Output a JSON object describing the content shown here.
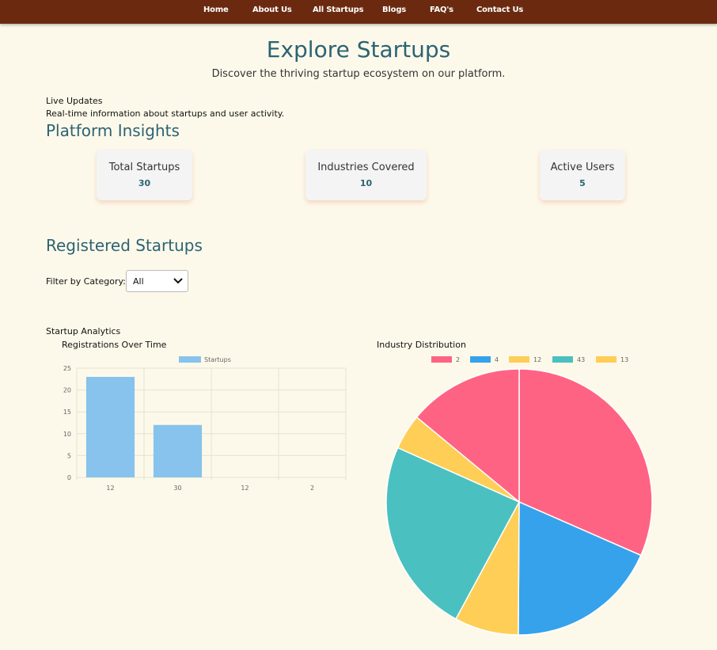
{
  "nav": {
    "items": [
      "Home",
      "About Us",
      "All Startups",
      "Blogs",
      "FAQ's",
      "Contact Us"
    ]
  },
  "hero": {
    "title": "Explore Startups",
    "subtitle": "Discover the thriving startup ecosystem on our platform."
  },
  "live": {
    "heading": "Live Updates",
    "description": "Real-time information about startups and user activity."
  },
  "insights": {
    "heading": "Platform Insights",
    "cards": [
      {
        "label": "Total Startups",
        "value": "30"
      },
      {
        "label": "Industries Covered",
        "value": "10"
      },
      {
        "label": "Active Users",
        "value": "5"
      }
    ]
  },
  "registered": {
    "heading": "Registered Startups",
    "filter_label": "Filter by Category:",
    "filter_value": "All"
  },
  "analytics": {
    "heading": "Startup Analytics"
  },
  "colors": {
    "accent": "#2c6373",
    "nav_bg": "#6b2a10",
    "page_bg": "#fdf9ea"
  },
  "chart_data": [
    {
      "type": "bar",
      "title": "Registrations Over Time",
      "categories": [
        "12",
        "30",
        "12",
        "2"
      ],
      "series": [
        {
          "name": "Startups",
          "values": [
            23,
            12,
            0,
            0
          ],
          "color": "#87c3ec"
        }
      ],
      "ylim": [
        0,
        25
      ],
      "yticks": [
        "0",
        "5",
        "10",
        "15",
        "20",
        "25"
      ],
      "grid": true,
      "legend": "top"
    },
    {
      "type": "pie",
      "title": "Industry Distribution",
      "labels": [
        "2",
        "4",
        "12",
        "43",
        "13"
      ],
      "values": [
        30,
        17.6,
        7.4,
        22.6,
        4.1,
        13.3
      ],
      "slice_labels": [
        "2",
        "4",
        "12",
        "43",
        "13",
        "2"
      ],
      "colors": [
        "#ff6384",
        "#36a2eb",
        "#ffce56",
        "#4bc0c0",
        "#ffce56",
        "#ff6384"
      ],
      "legend": "top"
    }
  ]
}
